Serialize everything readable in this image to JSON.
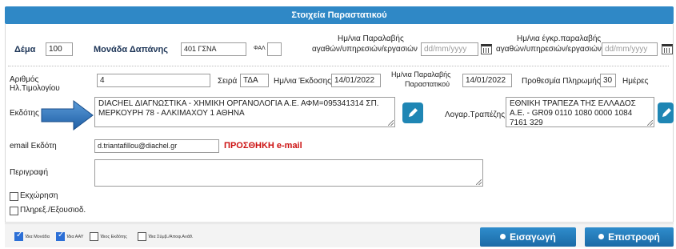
{
  "header": {
    "title": "Στοιχεία Παραστατικού"
  },
  "row1": {
    "dema_label": "Δέμα",
    "dema_value": "100",
    "monada_label": "Μονάδα Δαπάνης",
    "monada_value": "401 ΓΣΝΑ",
    "fal_label": "ΦΑΛ",
    "fal_value": "",
    "parlabi_label_1": "Ημ/νια Παραλαβής",
    "parlabi_label_2": "αγαθών/υπηρεσιών/εργασιών",
    "parlabi_placeholder": "dd/mm/yyyy",
    "egkrisi_label_1": "Ημ/νια έγκρ.παραλαβής",
    "egkrisi_label_2": "αγαθών/υπηρεσιών/εργασιών",
    "egkrisi_placeholder": "dd/mm/yyyy"
  },
  "row2": {
    "arithmos_label_1": "Αριθμός",
    "arithmos_label_2": "Ηλ.Τιμολογίου",
    "arithmos_value": "4",
    "seira_label": "Σειρά",
    "seira_value": "ΤΔΑ",
    "ekdosi_label": "Ημ/νια Έκδοσης",
    "ekdosi_value": "14/01/2022",
    "parast_label_1": "Ημ/νια Παραλαβής",
    "parast_label_2": "Παραστατικού",
    "parast_value": "14/01/2022",
    "prothesmia_label": "Προθεσμία Πληρωμής",
    "prothesmia_value": "30",
    "imeres_label": "Ημέρες"
  },
  "row3": {
    "ekdotis_label": "Εκδότης",
    "ekdotis_value": "DIACHEL ΔΙΑΓΝΩΣΤΙΚΑ - ΧΗΜΙΚΗ ΟΡΓΑΝΟΛΟΓΙΑ Α.Ε. ΑΦΜ=095341314 ΣΠ. ΜΕΡΚΟΥΡΗ 78 - ΑΛΚΙΜΑΧΟΥ 1 ΑΘΗΝΑ",
    "logar_label": "Λογαρ.Τραπέζης",
    "logar_value": "ΕΘΝΙΚΗ ΤΡΑΠΕΖΑ ΤΗΣ ΕΛΛΑΔΟΣ Α.Ε. - GR09 0110 1080 0000 1084 7161 329"
  },
  "row4": {
    "email_label": "email Εκδότη",
    "email_value": "d.triantafillou@diachel.gr",
    "add_email": "ΠΡΟΣΘΗΚΗ e-mail"
  },
  "row5": {
    "perigrafi_label": "Περιγραφή",
    "perigrafi_value": ""
  },
  "checks": {
    "ekxorisi": "Εκχώρηση",
    "plirex": "Πληρεξ./Εξουσιοδ."
  },
  "footer": {
    "cb1": "Ίδια Μονάδα",
    "cb2": "Ίδια ΑΑΥ",
    "cb3": "Ίδιος Εκδότης",
    "cb4": "Ίδια Σύμβ./Αποφ.Ανάθ.",
    "insert": "Εισαγωγή",
    "back": "Επιστροφή"
  },
  "colors": {
    "header": "#2f88c6",
    "button": "#1b6aa6",
    "red": "#cc1111",
    "checked": "#2c6fd6"
  },
  "icons": [
    "calendar-icon",
    "pencil-icon",
    "arrow-icon"
  ]
}
